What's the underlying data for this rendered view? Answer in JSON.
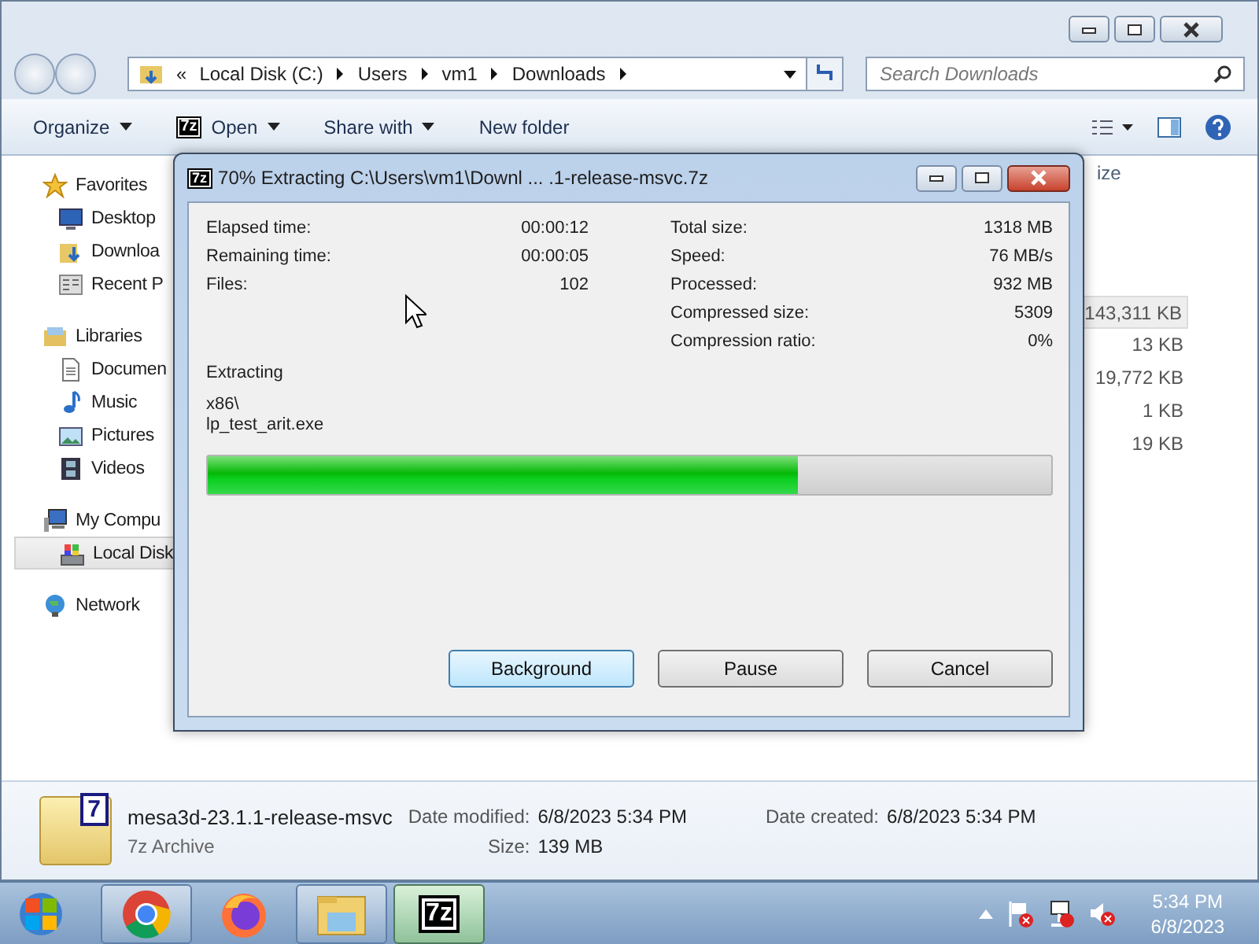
{
  "explorer": {
    "address": {
      "overflow": "«",
      "crumbs": [
        "Local Disk (C:)",
        "Users",
        "vm1",
        "Downloads"
      ]
    },
    "search": {
      "placeholder": "Search Downloads"
    },
    "toolbar": [
      {
        "label": "Organize",
        "dropdown": true
      },
      {
        "label": "Open",
        "logo": "7z",
        "dropdown": true
      },
      {
        "label": "Share with",
        "dropdown": true
      },
      {
        "label": "New folder",
        "dropdown": false
      }
    ],
    "sidebar": [
      {
        "label": "Favorites",
        "kind": "favorites",
        "children": [
          {
            "label": "Desktop",
            "kind": "desktop",
            "selected": false
          },
          {
            "label": "Downloa",
            "kind": "downloads",
            "selected": false
          },
          {
            "label": "Recent P",
            "kind": "recent",
            "selected": false
          }
        ]
      },
      {
        "label": "Libraries",
        "kind": "libraries",
        "children": [
          {
            "label": "Documen",
            "kind": "documents",
            "selected": false
          },
          {
            "label": "Music",
            "kind": "music",
            "selected": false
          },
          {
            "label": "Pictures",
            "kind": "pictures",
            "selected": false
          },
          {
            "label": "Videos",
            "kind": "videos",
            "selected": false
          }
        ]
      },
      {
        "label": "My Compu",
        "kind": "computer",
        "children": [
          {
            "label": "Local Disk",
            "kind": "disk",
            "selected": true
          }
        ]
      },
      {
        "label": "Network",
        "kind": "network"
      }
    ],
    "size_column": {
      "header": "ize",
      "rows": [
        {
          "size": "143,311 KB",
          "selected": true
        },
        {
          "size": "13 KB",
          "selected": false
        },
        {
          "size": "19,772 KB",
          "selected": false
        },
        {
          "size": "1 KB",
          "selected": false
        },
        {
          "size": "19 KB",
          "selected": false
        }
      ]
    },
    "details": {
      "logo": "7",
      "name": "mesa3d-23.1.1-release-msvc",
      "type": "7z Archive",
      "fields": [
        {
          "label": "Date modified:",
          "value": "6/8/2023 5:34 PM"
        },
        {
          "label": "Size:",
          "value": "139 MB"
        },
        {
          "label": "Date created:",
          "value": "6/8/2023 5:34 PM"
        }
      ]
    }
  },
  "dialog": {
    "logo": "7z",
    "title": "70% Extracting C:\\Users\\vm1\\Downl ... .1-release-msvc.7z",
    "left_stats": [
      {
        "label": "Elapsed time:",
        "value": "00:00:12"
      },
      {
        "label": "Remaining time:",
        "value": "00:00:05"
      },
      {
        "label": "Files:",
        "value": "102"
      }
    ],
    "right_stats": [
      {
        "label": "Total size:",
        "value": "1318 MB"
      },
      {
        "label": "Speed:",
        "value": "76 MB/s"
      },
      {
        "label": "Processed:",
        "value": "932 MB"
      },
      {
        "label": "Compressed size:",
        "value": "5309"
      },
      {
        "label": "Compression ratio:",
        "value": "0%"
      }
    ],
    "operation": "Extracting",
    "path": "x86\\",
    "file": "lp_test_arit.exe",
    "level": 0.7,
    "buttons": [
      {
        "label": "Background",
        "default": true
      },
      {
        "label": "Pause",
        "default": false
      },
      {
        "label": "Cancel",
        "default": false
      }
    ]
  },
  "taskbar": {
    "apps": [
      {
        "kind": "chrome",
        "running": true,
        "selected": false
      },
      {
        "kind": "firefox",
        "running": false,
        "selected": false
      },
      {
        "kind": "explorer",
        "running": true,
        "selected": false
      },
      {
        "kind": "sevenzip",
        "logo": "7z",
        "running": true,
        "selected": true
      }
    ],
    "clock": {
      "time": "5:34 PM",
      "date": "6/8/2023"
    }
  }
}
